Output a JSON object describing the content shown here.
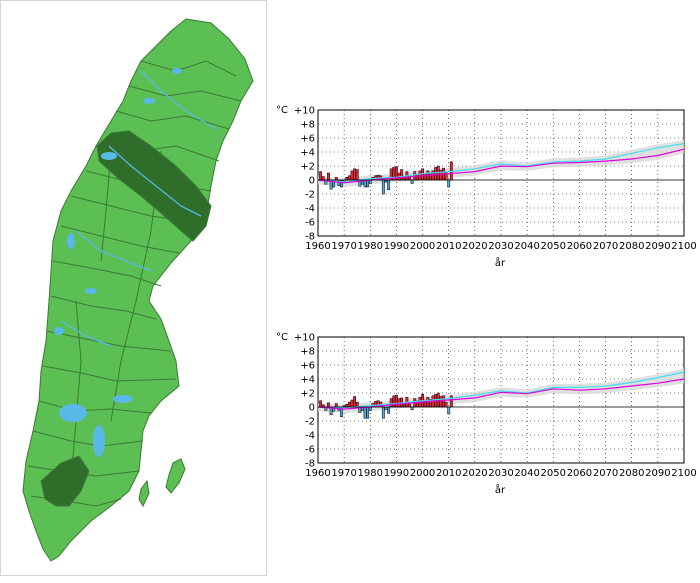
{
  "colors": {
    "land": "#5cbf54",
    "land_stroke": "#3a7a34",
    "highlight": "#2e6e2a",
    "water": "#58b8e8",
    "positive_bar": "#e8283a",
    "negative_bar": "#5aa8d8",
    "line_a": "#e000e0",
    "line_b": "#40e0f0",
    "band": "#d8d8d8"
  },
  "map": {
    "highlighted_regions": [
      "north-central-basin",
      "south-west-basin"
    ]
  },
  "chart_data": [
    {
      "type": "bar+line",
      "unit_label": "°C",
      "xlabel": "år",
      "ylim": [
        -8,
        10
      ],
      "y_ticks": [
        "+10",
        "+8",
        "+6",
        "+4",
        "+2",
        "0",
        "-2",
        "-4",
        "-6",
        "-8"
      ],
      "x_ticks": [
        "1960",
        "1970",
        "1980",
        "1990",
        "2000",
        "2010",
        "2020",
        "2030",
        "2040",
        "2050",
        "2060",
        "2070",
        "2080",
        "2090",
        "2100"
      ],
      "grid": true,
      "observed": {
        "years": [
          1961,
          1962,
          1963,
          1964,
          1965,
          1966,
          1967,
          1968,
          1969,
          1970,
          1971,
          1972,
          1973,
          1974,
          1975,
          1976,
          1977,
          1978,
          1979,
          1980,
          1981,
          1982,
          1983,
          1984,
          1985,
          1986,
          1987,
          1988,
          1989,
          1990,
          1991,
          1992,
          1993,
          1994,
          1995,
          1996,
          1997,
          1998,
          1999,
          2000,
          2001,
          2002,
          2003,
          2004,
          2005,
          2006,
          2007,
          2008,
          2009,
          2010,
          2011
        ],
        "values": [
          1.2,
          0.5,
          -0.6,
          1.0,
          -1.3,
          -1.0,
          0.4,
          -0.8,
          -1.0,
          -0.3,
          0.4,
          0.6,
          1.3,
          1.6,
          1.5,
          -0.9,
          -0.6,
          -1.0,
          -1.0,
          -0.5,
          0.4,
          0.6,
          0.7,
          0.6,
          -2.0,
          -0.3,
          -1.4,
          1.6,
          1.8,
          1.9,
          1.0,
          1.5,
          0.4,
          1.2,
          0.5,
          -0.5,
          1.2,
          0.8,
          1.3,
          1.6,
          0.9,
          1.3,
          1.0,
          1.3,
          1.8,
          2.0,
          1.4,
          1.7,
          1.0,
          -1.0,
          2.6
        ]
      },
      "scenario_lines": {
        "years": [
          1960,
          1970,
          1980,
          1990,
          2000,
          2010,
          2020,
          2030,
          2040,
          2050,
          2060,
          2070,
          2080,
          2090,
          2100
        ],
        "line_b": [
          0.0,
          -0.3,
          0.2,
          0.4,
          0.9,
          1.2,
          1.6,
          2.3,
          2.0,
          2.6,
          2.7,
          3.0,
          3.8,
          4.6,
          5.2
        ],
        "line_a": [
          0.0,
          -0.4,
          0.0,
          0.3,
          0.6,
          0.9,
          1.2,
          2.0,
          1.9,
          2.4,
          2.5,
          2.7,
          3.0,
          3.5,
          4.4
        ]
      }
    },
    {
      "type": "bar+line",
      "unit_label": "°C",
      "xlabel": "år",
      "ylim": [
        -8,
        10
      ],
      "y_ticks": [
        "+10",
        "+8",
        "+6",
        "+4",
        "+2",
        "0",
        "-2",
        "-4",
        "-6",
        "-8"
      ],
      "x_ticks": [
        "1960",
        "1970",
        "1980",
        "1990",
        "2000",
        "2010",
        "2020",
        "2030",
        "2040",
        "2050",
        "2060",
        "2070",
        "2080",
        "2090",
        "2100"
      ],
      "grid": true,
      "observed": {
        "years": [
          1961,
          1962,
          1963,
          1964,
          1965,
          1966,
          1967,
          1968,
          1969,
          1970,
          1971,
          1972,
          1973,
          1974,
          1975,
          1976,
          1977,
          1978,
          1979,
          1980,
          1981,
          1982,
          1983,
          1984,
          1985,
          1986,
          1987,
          1988,
          1989,
          1990,
          1991,
          1992,
          1993,
          1994,
          1995,
          1996,
          1997,
          1998,
          1999,
          2000,
          2001,
          2002,
          2003,
          2004,
          2005,
          2006,
          2007,
          2008,
          2009,
          2010,
          2011
        ],
        "values": [
          0.9,
          0.3,
          -0.5,
          0.6,
          -1.1,
          -0.6,
          0.5,
          -0.5,
          -1.4,
          0.2,
          0.4,
          0.7,
          1.0,
          1.5,
          0.7,
          -0.8,
          -0.5,
          -1.6,
          -1.6,
          -0.5,
          0.5,
          0.8,
          0.9,
          0.7,
          -1.6,
          -0.4,
          -0.9,
          1.2,
          1.6,
          1.7,
          1.2,
          1.3,
          0.5,
          1.4,
          0.6,
          -0.4,
          1.2,
          0.9,
          1.4,
          1.8,
          1.0,
          1.4,
          1.1,
          1.6,
          1.8,
          2.0,
          1.5,
          1.6,
          0.7,
          -1.0,
          1.6
        ]
      },
      "scenario_lines": {
        "years": [
          1960,
          1970,
          1980,
          1990,
          2000,
          2010,
          2020,
          2030,
          2040,
          2050,
          2060,
          2070,
          2080,
          2090,
          2100
        ],
        "line_b": [
          0.0,
          -0.1,
          0.2,
          0.5,
          0.9,
          1.2,
          1.7,
          2.3,
          2.0,
          2.8,
          2.8,
          3.0,
          3.5,
          4.2,
          5.0
        ],
        "line_a": [
          0.0,
          -0.3,
          0.0,
          0.4,
          0.7,
          1.0,
          1.3,
          2.1,
          1.9,
          2.6,
          2.4,
          2.6,
          3.0,
          3.4,
          4.0
        ]
      }
    }
  ]
}
